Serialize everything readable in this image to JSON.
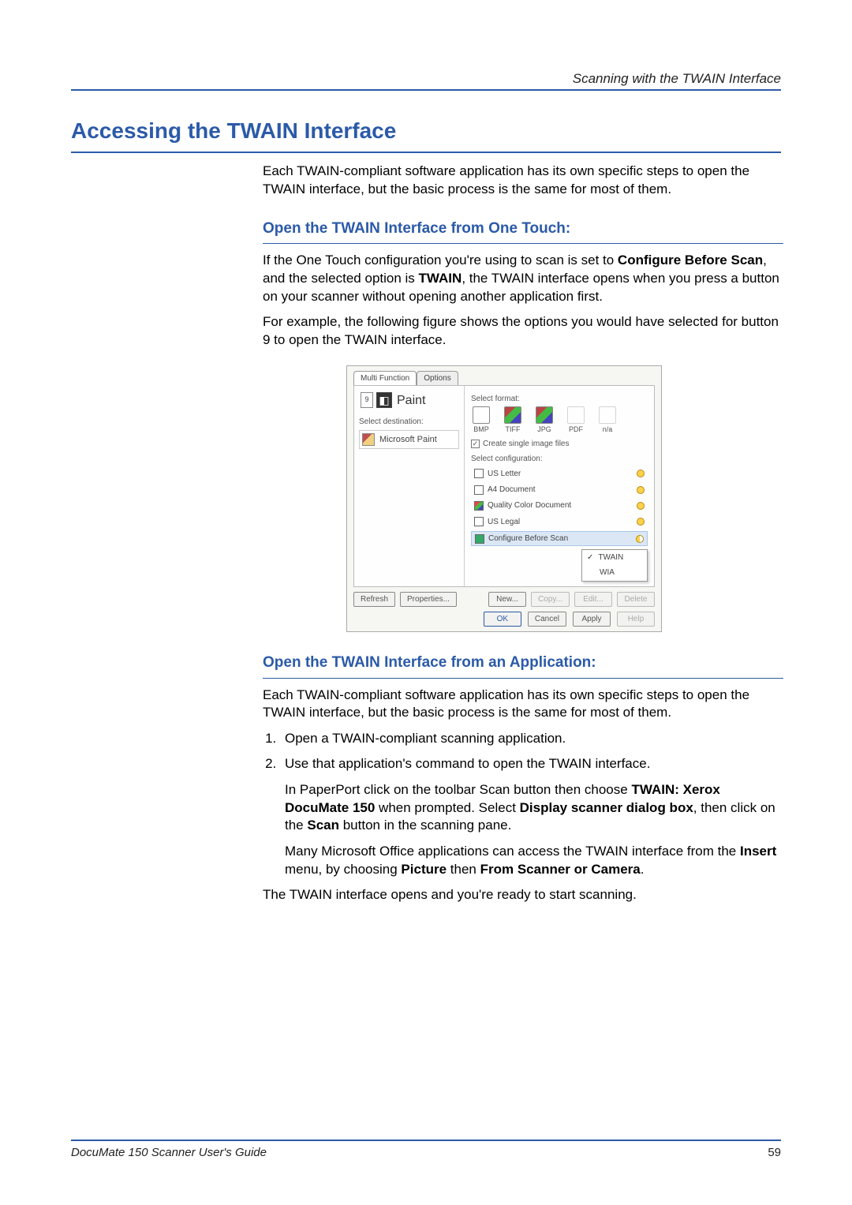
{
  "header": {
    "running": "Scanning with the TWAIN Interface"
  },
  "section": {
    "title": "Accessing the TWAIN Interface",
    "intro": "Each TWAIN-compliant software application has its own specific steps to open the TWAIN interface, but the basic process is the same for most of them."
  },
  "sub1": {
    "title": "Open the TWAIN Interface from One Touch:",
    "p1a": "If the One Touch configuration you're using to scan is set to ",
    "p1b": "Configure Before Scan",
    "p1c": ", and the selected option is ",
    "p1d": "TWAIN",
    "p1e": ", the TWAIN interface opens when you press a button on your scanner without opening another application first.",
    "p2": "For example, the following figure shows the options you would have selected for button 9 to open the TWAIN interface."
  },
  "figure": {
    "tabs": {
      "t1": "Multi Function",
      "t2": "Options"
    },
    "badge": "9",
    "paint_label": "Paint",
    "select_destination": "Select destination:",
    "dest_item": "Microsoft Paint",
    "select_format": "Select format:",
    "formats": [
      {
        "code": "BMP",
        "dim": false,
        "color": false
      },
      {
        "code": "TIFF",
        "dim": false,
        "color": true
      },
      {
        "code": "JPG",
        "dim": false,
        "color": true
      },
      {
        "code": "PDF",
        "dim": true,
        "color": false
      },
      {
        "code": "n/a",
        "dim": true,
        "color": false
      }
    ],
    "create_single": "Create single image files",
    "select_config": "Select configuration:",
    "configs": [
      {
        "label": "US Letter",
        "icon": "doc"
      },
      {
        "label": "A4 Document",
        "icon": "doc"
      },
      {
        "label": "Quality Color Document",
        "icon": "color"
      },
      {
        "label": "US Legal",
        "icon": "doc"
      },
      {
        "label": "Configure Before Scan",
        "icon": "gear",
        "selected": true
      }
    ],
    "submenu": {
      "opt1": "TWAIN",
      "opt2": "WIA"
    },
    "buttons": {
      "refresh": "Refresh",
      "properties": "Properties...",
      "new": "New...",
      "copy": "Copy...",
      "edit": "Edit...",
      "delete": "Delete",
      "ok": "OK",
      "cancel": "Cancel",
      "apply": "Apply",
      "help": "Help"
    }
  },
  "sub2": {
    "title": "Open the TWAIN Interface from an Application:",
    "intro": "Each TWAIN-compliant software application has its own specific steps to open the TWAIN interface, but the basic process is the same for most of them.",
    "step1": "Open a TWAIN-compliant scanning application.",
    "step2": "Use that application's command to open the TWAIN interface.",
    "step2_sub1_a": "In PaperPort click on the toolbar Scan button then choose ",
    "step2_sub1_b": "TWAIN: Xerox DocuMate 150",
    "step2_sub1_c": " when prompted. Select ",
    "step2_sub1_d": "Display scanner dialog box",
    "step2_sub1_e": ", then click on the ",
    "step2_sub1_f": "Scan",
    "step2_sub1_g": " button in the scanning pane.",
    "step2_sub2_a": "Many Microsoft Office applications can access the TWAIN interface from the ",
    "step2_sub2_b": "Insert",
    "step2_sub2_c": " menu, by choosing ",
    "step2_sub2_d": "Picture",
    "step2_sub2_e": " then ",
    "step2_sub2_f": "From Scanner or Camera",
    "step2_sub2_g": ".",
    "closing": "The TWAIN interface opens and you're ready to start scanning."
  },
  "footer": {
    "left": "DocuMate 150 Scanner User's Guide",
    "page": "59"
  }
}
